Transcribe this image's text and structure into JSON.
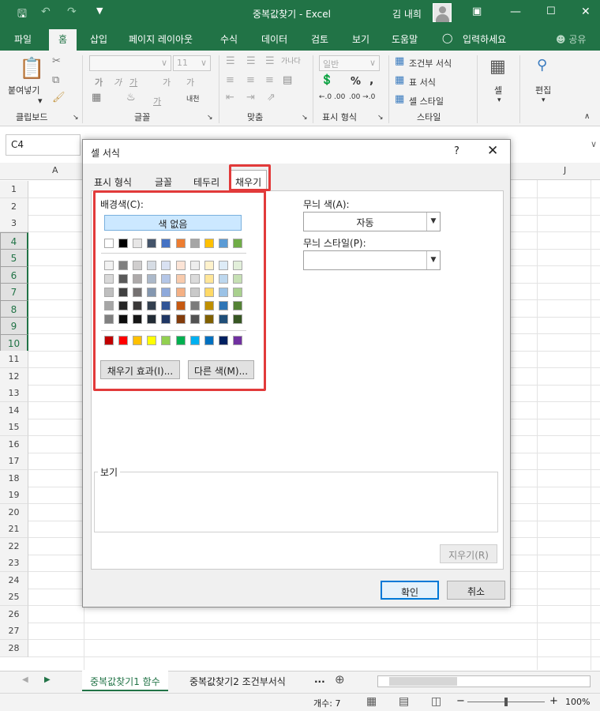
{
  "titlebar": {
    "title": "중복값찾기 - Excel",
    "user": "김 내희",
    "save_icon": "save-icon",
    "undo_icon": "undo-icon",
    "redo_icon": "redo-icon"
  },
  "menu": {
    "tabs": [
      "파일",
      "홈",
      "삽입",
      "페이지 레이아웃",
      "수식",
      "데이터",
      "검토",
      "보기",
      "도움말"
    ],
    "tell_me": "입력하세요",
    "share": "공유"
  },
  "ribbon": {
    "clipboard": {
      "paste": "붙여넣기",
      "group": "클립보드"
    },
    "font": {
      "size": "11",
      "group": "글꼴",
      "bold": "가",
      "italic": "가",
      "underline": "가",
      "grow": "가",
      "shrink": "가",
      "fill_letter": "가",
      "phonetic": "내천"
    },
    "align": {
      "group": "맞춤",
      "wrap": "가나다"
    },
    "number": {
      "format": "일반",
      "group": "표시 형식",
      "percent": "%",
      "comma": ",",
      "inc_dec": "←.0 .00",
      "dec_dec": ".00 →.0"
    },
    "styles": {
      "cond": "조건부 서식",
      "table": "표 서식",
      "cell": "셀 스타일",
      "group": "스타일"
    },
    "cells": {
      "label": "셀"
    },
    "edit": {
      "label": "편집"
    }
  },
  "formula_bar": {
    "name_box": "C4"
  },
  "grid": {
    "columns": [
      "A",
      "J"
    ],
    "rows": [
      "1",
      "2",
      "3",
      "4",
      "5",
      "6",
      "7",
      "8",
      "9",
      "10",
      "11",
      "12",
      "13",
      "14",
      "15",
      "16",
      "17",
      "18",
      "19",
      "20",
      "21",
      "22",
      "23",
      "24",
      "25",
      "26",
      "27",
      "28"
    ],
    "selected_rows": [
      "4",
      "5",
      "6",
      "7",
      "8",
      "9",
      "10"
    ]
  },
  "dialog": {
    "title": "셀 서식",
    "help": "?",
    "tabs": [
      "표시 형식",
      "글꼴",
      "테두리",
      "채우기"
    ],
    "active_tab": "채우기",
    "bg_label": "배경색(C):",
    "no_color": "색 없음",
    "theme_colors": [
      "#ffffff",
      "#000000",
      "#e7e6e6",
      "#44546a",
      "#4472c4",
      "#ed7d31",
      "#a5a5a5",
      "#ffc000",
      "#5b9bd5",
      "#70ad47"
    ],
    "shade_rows": [
      [
        "#f2f2f2",
        "#7f7f7f",
        "#d0cece",
        "#d6dce4",
        "#d9e1f2",
        "#fce4d6",
        "#ededed",
        "#fff2cc",
        "#ddebf7",
        "#e2efda"
      ],
      [
        "#d9d9d9",
        "#595959",
        "#aeaaaa",
        "#acb9ca",
        "#b4c6e7",
        "#f8cbad",
        "#dbdbdb",
        "#ffe699",
        "#bdd7ee",
        "#c6e0b4"
      ],
      [
        "#bfbfbf",
        "#404040",
        "#757171",
        "#8497b0",
        "#8ea9db",
        "#f4b084",
        "#c9c9c9",
        "#ffd966",
        "#9bc2e6",
        "#a9d08e"
      ],
      [
        "#a6a6a6",
        "#262626",
        "#3a3838",
        "#333f4f",
        "#305496",
        "#c65911",
        "#7b7b7b",
        "#bf8f00",
        "#2f75b5",
        "#548235"
      ],
      [
        "#808080",
        "#0d0d0d",
        "#161616",
        "#222b35",
        "#203764",
        "#833c0c",
        "#525252",
        "#806000",
        "#1f4e78",
        "#375623"
      ]
    ],
    "standard_colors": [
      "#c00000",
      "#ff0000",
      "#ffc000",
      "#ffff00",
      "#92d050",
      "#00b050",
      "#00b0f0",
      "#0070c0",
      "#002060",
      "#7030a0"
    ],
    "fill_effects": "채우기 효과(I)...",
    "more_colors": "다른 색(M)...",
    "pattern_color_label": "무늬 색(A):",
    "pattern_color_value": "자동",
    "pattern_style_label": "무늬 스타일(P):",
    "preview_label": "보기",
    "clear": "지우기(R)",
    "ok": "확인",
    "cancel": "취소"
  },
  "sheets": {
    "tabs": [
      "중복값찾기1 함수",
      "중복값찾기2 조건부서식"
    ],
    "more": "..."
  },
  "status": {
    "count": "개수: 7",
    "zoom": "100%"
  }
}
